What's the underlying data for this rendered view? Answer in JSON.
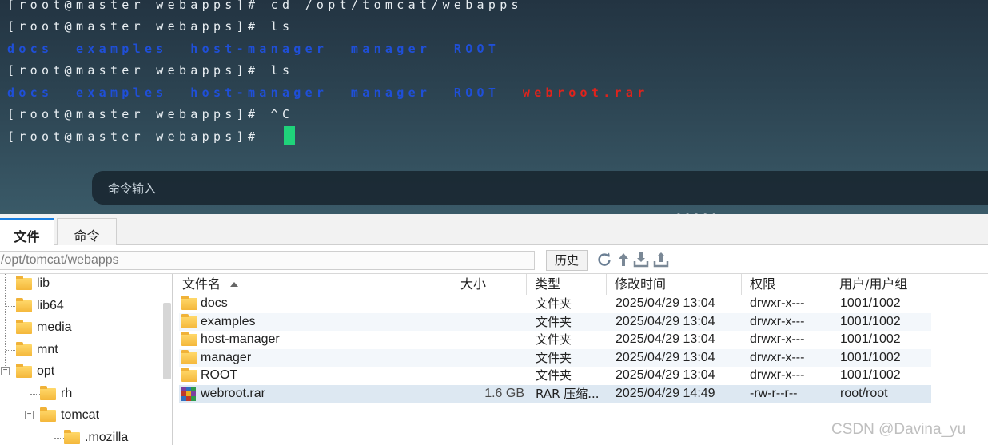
{
  "terminal": {
    "lines": [
      [
        {
          "text": "[root@master webapps]# cd /opt/tomcat/webapps",
          "color": "white"
        }
      ],
      [
        {
          "text": "[root@master webapps]# ls",
          "color": "white"
        }
      ],
      [
        {
          "text": "docs  examples  host-manager  manager  ROOT",
          "color": "blue"
        }
      ],
      [
        {
          "text": "[root@master webapps]# ls",
          "color": "white"
        }
      ],
      [
        {
          "text": "docs  examples  host-manager  manager  ROOT  ",
          "color": "blue"
        },
        {
          "text": "webroot.rar",
          "color": "red"
        }
      ],
      [
        {
          "text": "[root@master webapps]# ^C",
          "color": "white"
        }
      ],
      [
        {
          "text": "[root@master webapps]# ",
          "color": "white"
        }
      ]
    ],
    "command_input_placeholder": "命令输入",
    "cursor_color": "#1fd37a"
  },
  "tabs": [
    {
      "label": "文件",
      "active": true
    },
    {
      "label": "命令",
      "active": false
    }
  ],
  "pathbar": {
    "path": "/opt/tomcat/webapps",
    "history_label": "历史",
    "icons": [
      "refresh-icon",
      "up-directory-icon",
      "download-icon",
      "upload-icon"
    ]
  },
  "tree": {
    "items": [
      {
        "label": "lib",
        "type": "link-folder",
        "level": 1
      },
      {
        "label": "lib64",
        "type": "link-folder",
        "level": 1
      },
      {
        "label": "media",
        "type": "folder",
        "level": 1
      },
      {
        "label": "mnt",
        "type": "folder",
        "level": 1
      },
      {
        "label": "opt",
        "type": "folder",
        "level": 1,
        "expanded": true
      },
      {
        "label": "rh",
        "type": "folder",
        "level": 2
      },
      {
        "label": "tomcat",
        "type": "folder",
        "level": 2,
        "expanded": true
      },
      {
        "label": ".mozilla",
        "type": "folder",
        "level": 3
      }
    ]
  },
  "table": {
    "columns": [
      "文件名",
      "大小",
      "类型",
      "修改时间",
      "权限",
      "用户/用户组"
    ],
    "rows": [
      {
        "name": "docs",
        "size": "",
        "type": "文件夹",
        "mtime": "2025/04/29 13:04",
        "perm": "drwxr-x---",
        "owner": "1001/1002",
        "icon": "folder-icon"
      },
      {
        "name": "examples",
        "size": "",
        "type": "文件夹",
        "mtime": "2025/04/29 13:04",
        "perm": "drwxr-x---",
        "owner": "1001/1002",
        "icon": "folder-icon"
      },
      {
        "name": "host-manager",
        "size": "",
        "type": "文件夹",
        "mtime": "2025/04/29 13:04",
        "perm": "drwxr-x---",
        "owner": "1001/1002",
        "icon": "folder-icon"
      },
      {
        "name": "manager",
        "size": "",
        "type": "文件夹",
        "mtime": "2025/04/29 13:04",
        "perm": "drwxr-x---",
        "owner": "1001/1002",
        "icon": "folder-icon"
      },
      {
        "name": "ROOT",
        "size": "",
        "type": "文件夹",
        "mtime": "2025/04/29 13:04",
        "perm": "drwxr-x---",
        "owner": "1001/1002",
        "icon": "folder-icon"
      },
      {
        "name": "webroot.rar",
        "size": "1.6 GB",
        "type": "RAR 压缩...",
        "mtime": "2025/04/29 14:49",
        "perm": "-rw-r--r--",
        "owner": "root/root",
        "icon": "rar-archive-icon"
      }
    ]
  },
  "watermark": "CSDN @Davina_yu",
  "colors": {
    "terminal_blue": "#1f4fd8",
    "terminal_red": "#e0231c",
    "tab_accent": "#1a7fe0",
    "selected_row": "#dde8f2"
  }
}
